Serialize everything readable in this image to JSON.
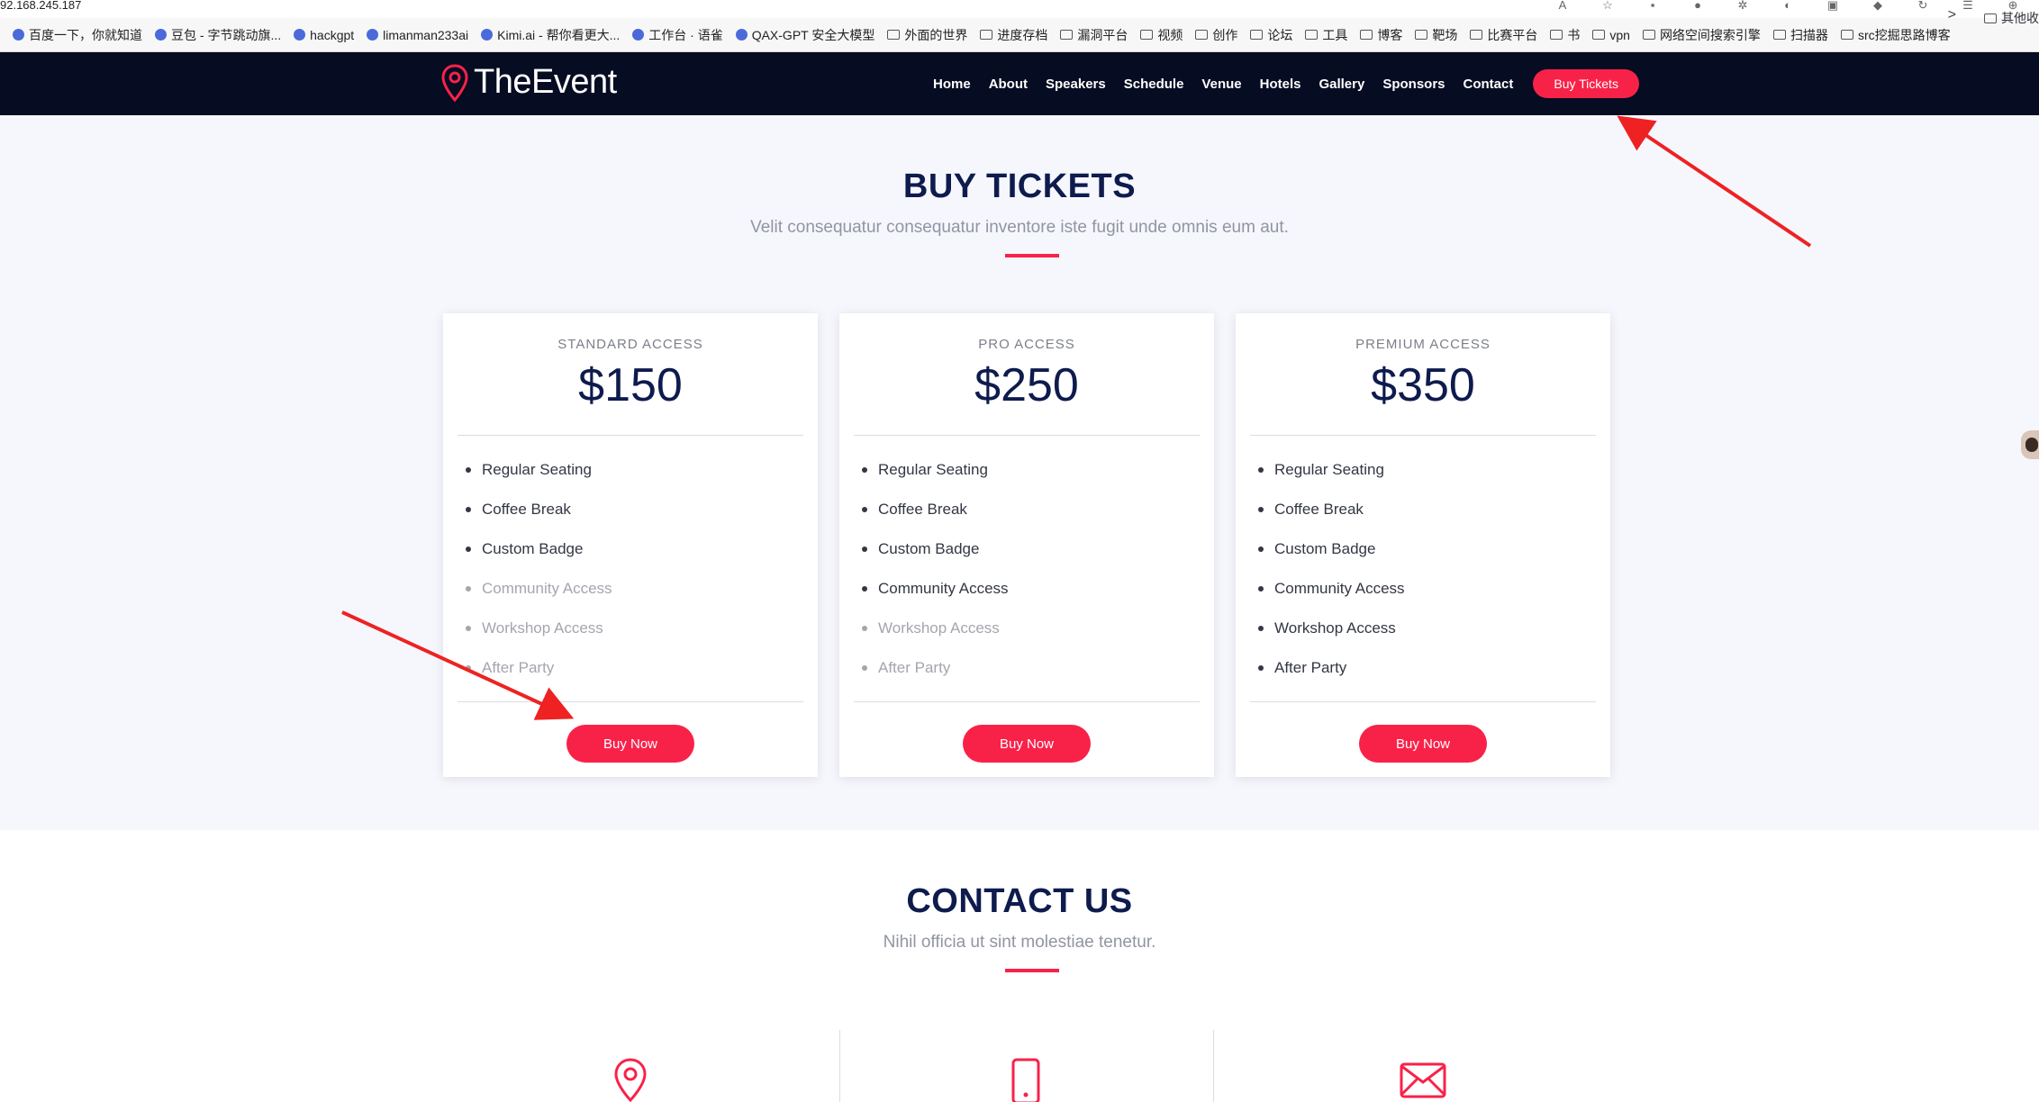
{
  "browser": {
    "url": "92.168.245.187",
    "bookmarks": [
      "百度一下，你就知道",
      "豆包 - 字节跳动旗...",
      "hackgpt",
      "limanman233ai",
      "Kimi.ai - 帮你看更大...",
      "工作台 · 语雀",
      "QAX-GPT 安全大模型",
      "外面的世界",
      "进度存档",
      "漏洞平台",
      "视频",
      "创作",
      "论坛",
      "工具",
      "博客",
      "靶场",
      "比赛平台",
      "书",
      "vpn",
      "网络空间搜索引擎",
      "扫描器",
      "src挖掘思路博客"
    ],
    "bookmarks_more": ">",
    "other_bookmarks": "其他收"
  },
  "header": {
    "logo_text": "TheEvent",
    "nav": [
      "Home",
      "About",
      "Speakers",
      "Schedule",
      "Venue",
      "Hotels",
      "Gallery",
      "Sponsors",
      "Contact"
    ],
    "cta_label": "Buy Tickets",
    "accent": "#f82249",
    "bg": "#060c22"
  },
  "tickets": {
    "title": "BUY TICKETS",
    "subtitle": "Velit consequatur consequatur inventore iste fugit unde omnis eum aut.",
    "plans": [
      {
        "tier": "STANDARD ACCESS",
        "price": "$150",
        "features": [
          {
            "label": "Regular Seating",
            "included": true
          },
          {
            "label": "Coffee Break",
            "included": true
          },
          {
            "label": "Custom Badge",
            "included": true
          },
          {
            "label": "Community Access",
            "included": false
          },
          {
            "label": "Workshop Access",
            "included": false
          },
          {
            "label": "After Party",
            "included": false
          }
        ],
        "button": "Buy Now"
      },
      {
        "tier": "PRO ACCESS",
        "price": "$250",
        "features": [
          {
            "label": "Regular Seating",
            "included": true
          },
          {
            "label": "Coffee Break",
            "included": true
          },
          {
            "label": "Custom Badge",
            "included": true
          },
          {
            "label": "Community Access",
            "included": true
          },
          {
            "label": "Workshop Access",
            "included": false
          },
          {
            "label": "After Party",
            "included": false
          }
        ],
        "button": "Buy Now"
      },
      {
        "tier": "PREMIUM ACCESS",
        "price": "$350",
        "features": [
          {
            "label": "Regular Seating",
            "included": true
          },
          {
            "label": "Coffee Break",
            "included": true
          },
          {
            "label": "Custom Badge",
            "included": true
          },
          {
            "label": "Community Access",
            "included": true
          },
          {
            "label": "Workshop Access",
            "included": true
          },
          {
            "label": "After Party",
            "included": true
          }
        ],
        "button": "Buy Now"
      }
    ]
  },
  "contact": {
    "title": "CONTACT US",
    "subtitle": "Nihil officia ut sint molestiae tenetur.",
    "icons": [
      "location-icon",
      "phone-icon",
      "mail-icon"
    ]
  },
  "annotations": {
    "arrow_color": "#ee2222"
  }
}
